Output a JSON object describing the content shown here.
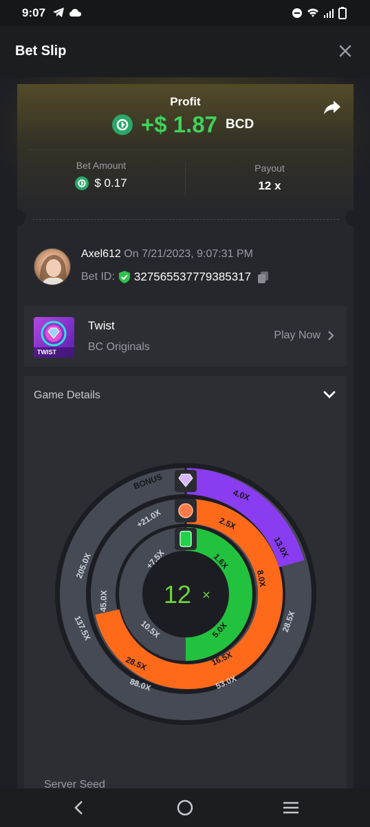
{
  "status_bar": {
    "time": "9:07"
  },
  "header": {
    "title": "Bet Slip"
  },
  "bet": {
    "profit_label": "Profit",
    "profit_amount": "+$ 1.87",
    "currency": "BCD",
    "bet_amount_label": "Bet Amount",
    "bet_amount_value": "$ 0.17",
    "payout_label": "Payout",
    "payout_value": "12 x"
  },
  "user": {
    "name": "Axel612",
    "date": "On 7/21/2023, 9:07:31 PM",
    "bet_id_label": "Bet ID:",
    "bet_id": "327565537779385317"
  },
  "game": {
    "name": "Twist",
    "provider": "BC Originals",
    "play_label": "Play Now",
    "thumb_badge": "TWIST"
  },
  "details": {
    "title": "Game Details",
    "result_value": "12",
    "result_symbol": "×",
    "outer_labels": [
      "BONUS",
      "4.0X",
      "13.0X",
      "28.5X",
      "53.0X",
      "88.0X",
      "137.5X",
      "205.0X"
    ],
    "middle_labels": [
      "+21.0X",
      "2.5X",
      "8.0X",
      "16.5X",
      "28.5X",
      "45.0X"
    ],
    "inner_labels": [
      "+7.5X",
      "1.6X",
      "5.0X",
      "10.5X"
    ],
    "server_seed_label": "Server Seed"
  },
  "colors": {
    "profit_green": "#3fd25a",
    "purple": "#8a3cf0",
    "orange": "#ff6a1a",
    "green": "#22c23e",
    "ring_gray": "#454a55"
  }
}
